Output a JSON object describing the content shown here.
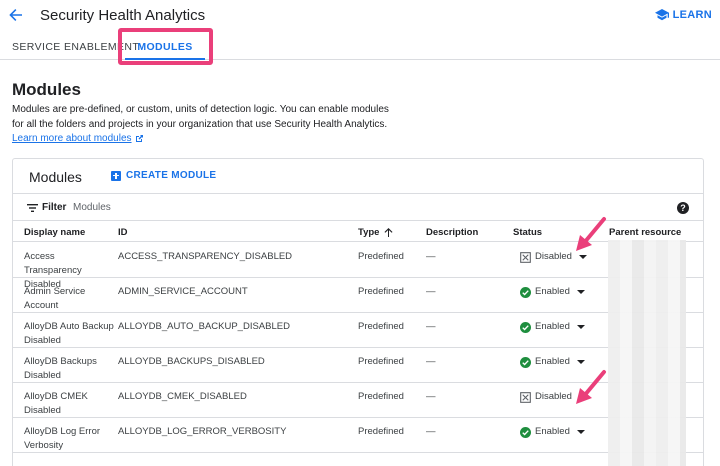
{
  "header": {
    "title": "Security Health Analytics",
    "learn_label": "LEARN"
  },
  "tabs": [
    {
      "label": "SERVICE ENABLEMENT"
    },
    {
      "label": "MODULES"
    }
  ],
  "page": {
    "title": "Modules",
    "description": "Modules are pre-defined, or custom, units of detection logic. You can enable modules for all the folders and projects in your organization that use Security Health Analytics.",
    "learn_more": "Learn more about modules"
  },
  "card": {
    "title": "Modules",
    "create_label": "CREATE MODULE",
    "filter_label": "Filter",
    "filter_placeholder": "Modules"
  },
  "table": {
    "columns": [
      "Display name",
      "ID",
      "Type",
      "Description",
      "Status",
      "Parent resource"
    ],
    "rows": [
      {
        "name": "Access Transparency Disabled",
        "id": "ACCESS_TRANSPARENCY_DISABLED",
        "type": "Predefined",
        "desc": "—",
        "status": "Disabled"
      },
      {
        "name": "Admin Service Account",
        "id": "ADMIN_SERVICE_ACCOUNT",
        "type": "Predefined",
        "desc": "—",
        "status": "Enabled"
      },
      {
        "name": "AlloyDB Auto Backup Disabled",
        "id": "ALLOYDB_AUTO_BACKUP_DISABLED",
        "type": "Predefined",
        "desc": "—",
        "status": "Enabled"
      },
      {
        "name": "AlloyDB Backups Disabled",
        "id": "ALLOYDB_BACKUPS_DISABLED",
        "type": "Predefined",
        "desc": "—",
        "status": "Enabled"
      },
      {
        "name": "AlloyDB CMEK Disabled",
        "id": "ALLOYDB_CMEK_DISABLED",
        "type": "Predefined",
        "desc": "—",
        "status": "Disabled"
      },
      {
        "name": "AlloyDB Log Error Verbosity",
        "id": "ALLOYDB_LOG_ERROR_VERBOSITY",
        "type": "Predefined",
        "desc": "—",
        "status": "Enabled"
      }
    ]
  },
  "colors": {
    "accent": "#1a73e8",
    "highlight": "#ea3f7a",
    "enabled": "#1e8e3e"
  }
}
